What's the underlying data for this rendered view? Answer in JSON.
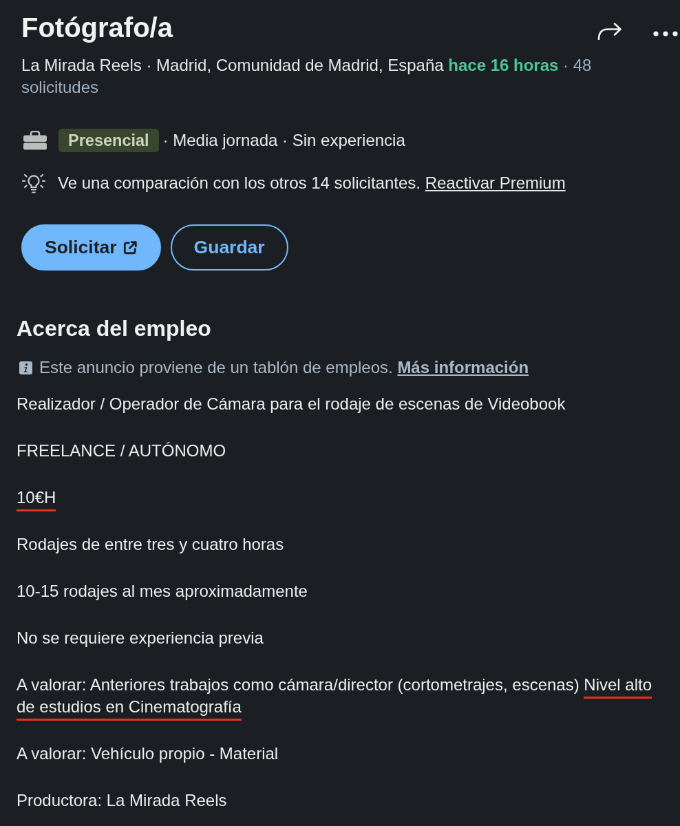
{
  "header": {
    "title": "Fotógrafo/a"
  },
  "meta": {
    "company_location": "La Mirada Reels · Madrid, Comunidad de Madrid, España",
    "posted": "hace 16 horas",
    "applicants": "· 48 solicitudes"
  },
  "job_insights": {
    "workplace_badge": "Presencial",
    "details": "· Media jornada · Sin experiencia"
  },
  "premium_insight": {
    "text": "Ve una comparación con los otros 14 solicitantes.",
    "link": "Reactivar Premium"
  },
  "buttons": [
    {
      "label": "Solicitar",
      "kind": "primary",
      "external": true
    },
    {
      "label": "Guardar",
      "kind": "secondary",
      "external": false
    }
  ],
  "about": {
    "heading": "Acerca del empleo",
    "notice": {
      "text": "Este anuncio proviene de un tablón de empleos.",
      "link": "Más información"
    },
    "paragraphs": [
      {
        "segments": [
          {
            "text": "Realizador / Operador de Cámara para el rodaje de escenas de Videobook",
            "marked": false
          }
        ]
      },
      {
        "segments": [
          {
            "text": "FREELANCE / AUTÓNOMO",
            "marked": false
          }
        ]
      },
      {
        "segments": [
          {
            "text": "10€H",
            "marked": true
          }
        ]
      },
      {
        "segments": [
          {
            "text": "Rodajes de entre tres y cuatro horas",
            "marked": false
          }
        ]
      },
      {
        "segments": [
          {
            "text": "10-15 rodajes al mes aproximadamente",
            "marked": false
          }
        ]
      },
      {
        "segments": [
          {
            "text": "No se requiere experiencia previa",
            "marked": false
          }
        ]
      },
      {
        "segments": [
          {
            "text": "A valorar: Anteriores trabajos como cámara/director (cortometrajes, escenas)",
            "marked": false
          },
          {
            "text": "Nivel alto de estudios en Cinematografía",
            "marked": true
          }
        ]
      },
      {
        "segments": [
          {
            "text": "A valorar: Vehículo propio - Material",
            "marked": false
          }
        ]
      },
      {
        "segments": [
          {
            "text": "Productora: La Mirada Reels",
            "marked": false
          }
        ]
      }
    ]
  }
}
